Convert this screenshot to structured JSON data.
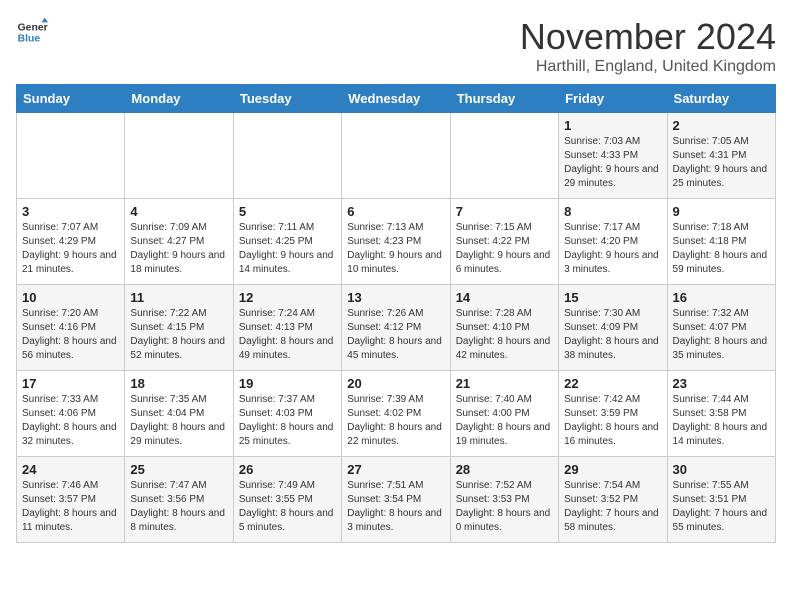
{
  "header": {
    "month_title": "November 2024",
    "location": "Harthill, England, United Kingdom",
    "logo_general": "General",
    "logo_blue": "Blue"
  },
  "weekdays": [
    "Sunday",
    "Monday",
    "Tuesday",
    "Wednesday",
    "Thursday",
    "Friday",
    "Saturday"
  ],
  "weeks": [
    [
      {
        "day": "",
        "info": ""
      },
      {
        "day": "",
        "info": ""
      },
      {
        "day": "",
        "info": ""
      },
      {
        "day": "",
        "info": ""
      },
      {
        "day": "",
        "info": ""
      },
      {
        "day": "1",
        "info": "Sunrise: 7:03 AM\nSunset: 4:33 PM\nDaylight: 9 hours\nand 29 minutes."
      },
      {
        "day": "2",
        "info": "Sunrise: 7:05 AM\nSunset: 4:31 PM\nDaylight: 9 hours\nand 25 minutes."
      }
    ],
    [
      {
        "day": "3",
        "info": "Sunrise: 7:07 AM\nSunset: 4:29 PM\nDaylight: 9 hours\nand 21 minutes."
      },
      {
        "day": "4",
        "info": "Sunrise: 7:09 AM\nSunset: 4:27 PM\nDaylight: 9 hours\nand 18 minutes."
      },
      {
        "day": "5",
        "info": "Sunrise: 7:11 AM\nSunset: 4:25 PM\nDaylight: 9 hours\nand 14 minutes."
      },
      {
        "day": "6",
        "info": "Sunrise: 7:13 AM\nSunset: 4:23 PM\nDaylight: 9 hours\nand 10 minutes."
      },
      {
        "day": "7",
        "info": "Sunrise: 7:15 AM\nSunset: 4:22 PM\nDaylight: 9 hours\nand 6 minutes."
      },
      {
        "day": "8",
        "info": "Sunrise: 7:17 AM\nSunset: 4:20 PM\nDaylight: 9 hours\nand 3 minutes."
      },
      {
        "day": "9",
        "info": "Sunrise: 7:18 AM\nSunset: 4:18 PM\nDaylight: 8 hours\nand 59 minutes."
      }
    ],
    [
      {
        "day": "10",
        "info": "Sunrise: 7:20 AM\nSunset: 4:16 PM\nDaylight: 8 hours\nand 56 minutes."
      },
      {
        "day": "11",
        "info": "Sunrise: 7:22 AM\nSunset: 4:15 PM\nDaylight: 8 hours\nand 52 minutes."
      },
      {
        "day": "12",
        "info": "Sunrise: 7:24 AM\nSunset: 4:13 PM\nDaylight: 8 hours\nand 49 minutes."
      },
      {
        "day": "13",
        "info": "Sunrise: 7:26 AM\nSunset: 4:12 PM\nDaylight: 8 hours\nand 45 minutes."
      },
      {
        "day": "14",
        "info": "Sunrise: 7:28 AM\nSunset: 4:10 PM\nDaylight: 8 hours\nand 42 minutes."
      },
      {
        "day": "15",
        "info": "Sunrise: 7:30 AM\nSunset: 4:09 PM\nDaylight: 8 hours\nand 38 minutes."
      },
      {
        "day": "16",
        "info": "Sunrise: 7:32 AM\nSunset: 4:07 PM\nDaylight: 8 hours\nand 35 minutes."
      }
    ],
    [
      {
        "day": "17",
        "info": "Sunrise: 7:33 AM\nSunset: 4:06 PM\nDaylight: 8 hours\nand 32 minutes."
      },
      {
        "day": "18",
        "info": "Sunrise: 7:35 AM\nSunset: 4:04 PM\nDaylight: 8 hours\nand 29 minutes."
      },
      {
        "day": "19",
        "info": "Sunrise: 7:37 AM\nSunset: 4:03 PM\nDaylight: 8 hours\nand 25 minutes."
      },
      {
        "day": "20",
        "info": "Sunrise: 7:39 AM\nSunset: 4:02 PM\nDaylight: 8 hours\nand 22 minutes."
      },
      {
        "day": "21",
        "info": "Sunrise: 7:40 AM\nSunset: 4:00 PM\nDaylight: 8 hours\nand 19 minutes."
      },
      {
        "day": "22",
        "info": "Sunrise: 7:42 AM\nSunset: 3:59 PM\nDaylight: 8 hours\nand 16 minutes."
      },
      {
        "day": "23",
        "info": "Sunrise: 7:44 AM\nSunset: 3:58 PM\nDaylight: 8 hours\nand 14 minutes."
      }
    ],
    [
      {
        "day": "24",
        "info": "Sunrise: 7:46 AM\nSunset: 3:57 PM\nDaylight: 8 hours\nand 11 minutes."
      },
      {
        "day": "25",
        "info": "Sunrise: 7:47 AM\nSunset: 3:56 PM\nDaylight: 8 hours\nand 8 minutes."
      },
      {
        "day": "26",
        "info": "Sunrise: 7:49 AM\nSunset: 3:55 PM\nDaylight: 8 hours\nand 5 minutes."
      },
      {
        "day": "27",
        "info": "Sunrise: 7:51 AM\nSunset: 3:54 PM\nDaylight: 8 hours\nand 3 minutes."
      },
      {
        "day": "28",
        "info": "Sunrise: 7:52 AM\nSunset: 3:53 PM\nDaylight: 8 hours\nand 0 minutes."
      },
      {
        "day": "29",
        "info": "Sunrise: 7:54 AM\nSunset: 3:52 PM\nDaylight: 7 hours\nand 58 minutes."
      },
      {
        "day": "30",
        "info": "Sunrise: 7:55 AM\nSunset: 3:51 PM\nDaylight: 7 hours\nand 55 minutes."
      }
    ]
  ]
}
